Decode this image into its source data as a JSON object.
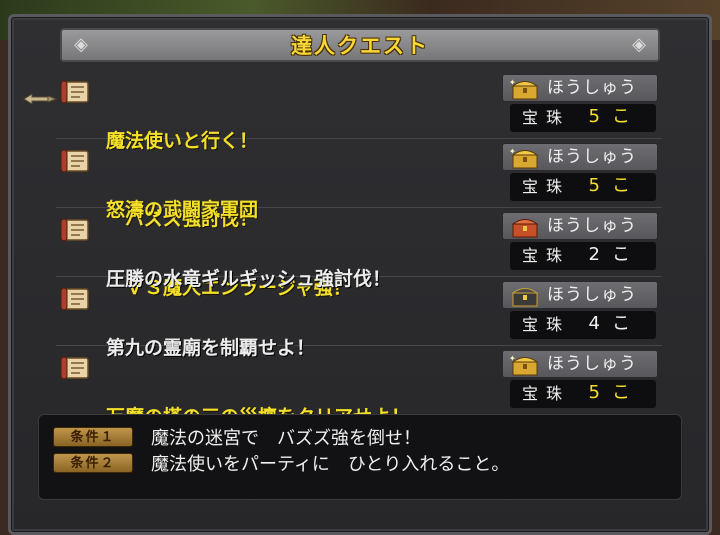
{
  "title": "達人クエスト",
  "reward_label": "ほうしゅう",
  "reward_item": "宝珠",
  "quests": [
    {
      "line1": "魔法使いと行く！",
      "line2": "　バズズ強討伐！",
      "color": "yellow",
      "count": "5こ",
      "chest": "gold"
    },
    {
      "line1": "怒濤の武闘家軍団",
      "line2": "　ＶＳ魔人エンラージャ強！",
      "color": "yellow",
      "count": "5こ",
      "chest": "gold"
    },
    {
      "line1": "圧勝の水竜ギルギッシュ強討伐！",
      "line2": "",
      "color": "white",
      "count": "2こ",
      "chest": "red"
    },
    {
      "line1": "第九の霊廟を制覇せよ！",
      "line2": "",
      "color": "white",
      "count": "4こ",
      "chest": "dark"
    },
    {
      "line1": "万魔の塔の三の災壇をクリアせよ！",
      "line2": "",
      "color": "yellow",
      "count": "5こ",
      "chest": "gold"
    }
  ],
  "conditions": [
    {
      "badge": "条件１",
      "text": "魔法の迷宮で　バズズ強を倒せ！"
    },
    {
      "badge": "条件２",
      "text": "魔法使いをパーティに　ひとり入れること。"
    }
  ],
  "colors": {
    "highlight": "#f4e028",
    "normal": "#ececec"
  }
}
